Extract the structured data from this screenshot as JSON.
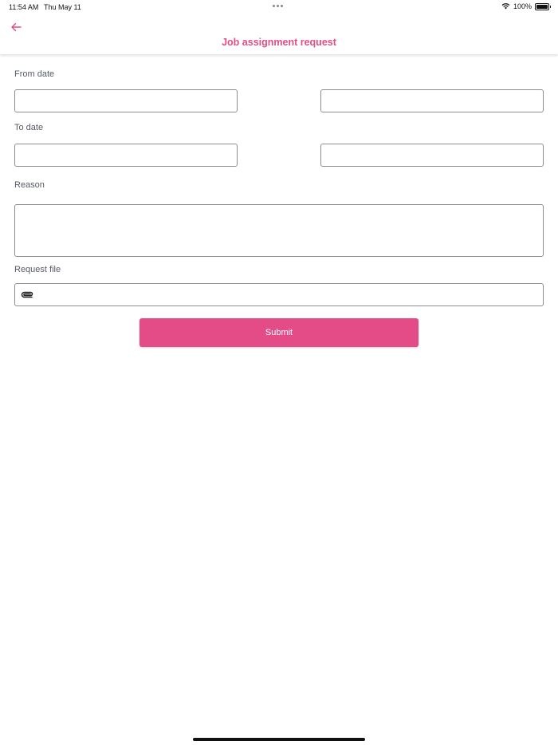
{
  "status_bar": {
    "time": "11:54 AM",
    "date": "Thu May 11",
    "battery_percent": "100%"
  },
  "header": {
    "back_icon": "arrow-left-icon",
    "title": "Job assignment request"
  },
  "form": {
    "from_date_label": "From date",
    "from_date_value": "",
    "from_time_value": "",
    "to_date_label": "To date",
    "to_date_value": "",
    "to_time_value": "",
    "reason_label": "Reason",
    "reason_value": "",
    "request_file_label": "Request file",
    "request_file_icon": "paperclip-icon",
    "submit_label": "Submit"
  },
  "colors": {
    "accent": "#e34c86",
    "label": "#555b66",
    "border": "#8a8d91"
  }
}
